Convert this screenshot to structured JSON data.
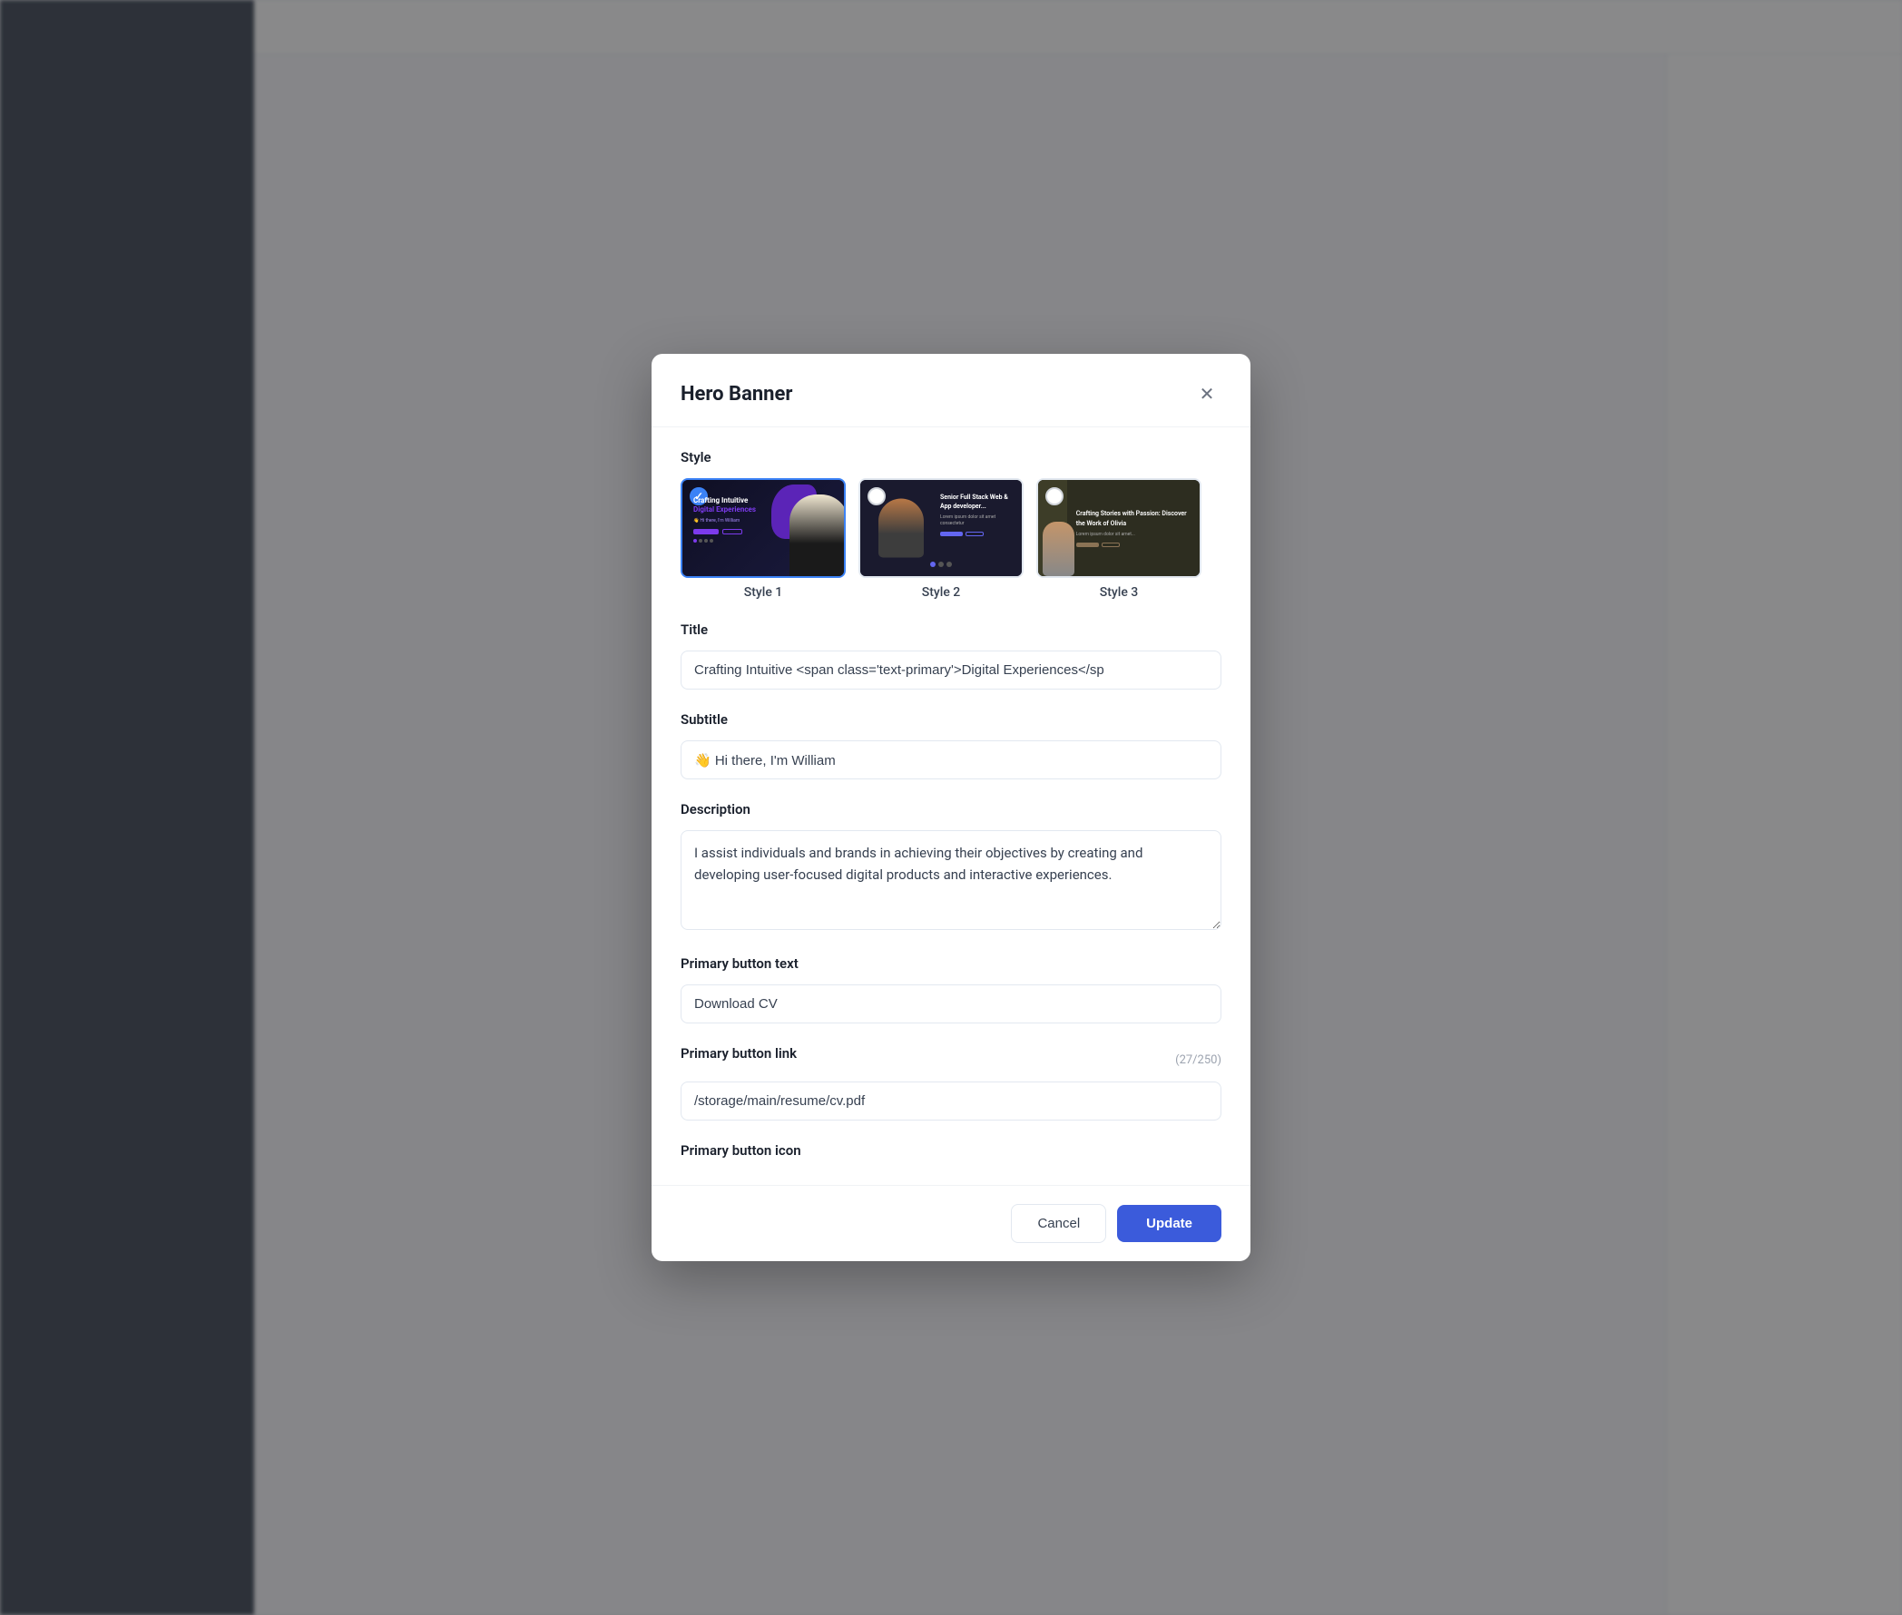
{
  "modal": {
    "title": "Hero Banner",
    "style_section_label": "Style",
    "styles": [
      {
        "id": "style1",
        "label": "Style 1",
        "selected": true
      },
      {
        "id": "style2",
        "label": "Style 2",
        "selected": false
      },
      {
        "id": "style3",
        "label": "Style 3",
        "selected": false
      }
    ],
    "fields": {
      "title_label": "Title",
      "title_value": "Crafting Intuitive <span class='text-primary'>Digital Experiences</sp",
      "subtitle_label": "Subtitle",
      "subtitle_value": "👋 Hi there, I'm William",
      "description_label": "Description",
      "description_value": "I assist individuals and brands in achieving their objectives by creating and developing user-focused digital products and interactive experiences.",
      "primary_button_text_label": "Primary button text",
      "primary_button_text_value": "Download CV",
      "primary_button_link_label": "Primary button link",
      "primary_button_link_value": "/storage/main/resume/cv.pdf",
      "primary_button_link_char_count": "(27/250)",
      "primary_button_icon_label": "Primary button icon"
    },
    "footer": {
      "cancel_label": "Cancel",
      "update_label": "Update"
    }
  }
}
